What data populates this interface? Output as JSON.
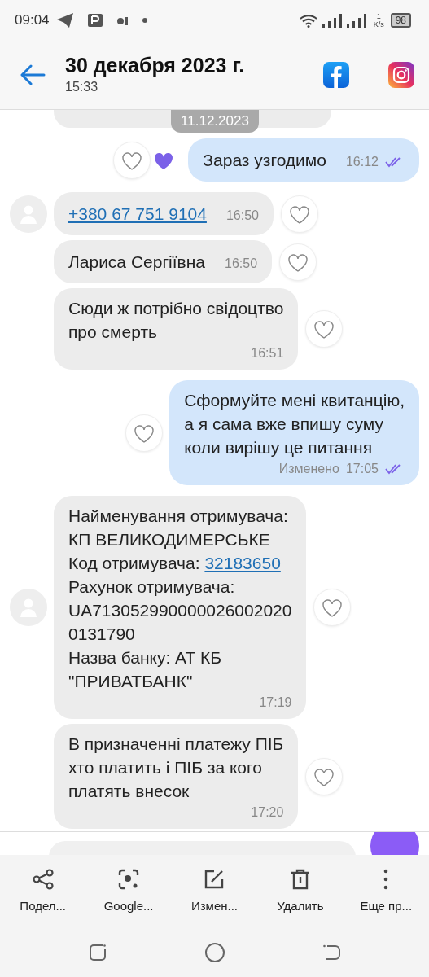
{
  "status_bar": {
    "time": "09:04",
    "net_speed_value": "1",
    "net_speed_unit": "K/s",
    "battery": "98"
  },
  "header": {
    "title": "30 декабря 2023 г.",
    "subtitle": "15:33"
  },
  "date_chip": "11.12.2023",
  "messages": [
    {
      "kind": "outgoing",
      "lines": [
        {
          "text": "Зараз узгодимо"
        }
      ],
      "time": "16:12",
      "read": true,
      "liked": true
    },
    {
      "kind": "incoming",
      "avatar": true,
      "lines": [
        {
          "link": "+380 67 751 9104"
        }
      ],
      "time": "16:50",
      "liked": false
    },
    {
      "kind": "incoming",
      "avatar": false,
      "lines": [
        {
          "text": "Лариса Сергіївна"
        }
      ],
      "time": "16:50",
      "liked": false
    },
    {
      "kind": "incoming",
      "avatar": false,
      "lines": [
        {
          "text": "Сюди ж потрібно свідоцтво"
        },
        {
          "text": "про смерть"
        }
      ],
      "time": "16:51",
      "liked": false
    },
    {
      "kind": "outgoing",
      "lines": [
        {
          "text": "Сформуйте мені квитанцію,"
        },
        {
          "text": "а я сама вже впишу суму"
        },
        {
          "text": "коли вирішу це питання"
        }
      ],
      "edited_label": "Изменено",
      "time": "17:05",
      "read": true,
      "liked": false
    },
    {
      "kind": "incoming",
      "avatar": true,
      "lines": [
        {
          "text": "Найменування отримувача:"
        },
        {
          "text": "КП ВЕЛИКОДИМЕРСЬКЕ"
        },
        {
          "text": "Код отримувача: ",
          "link": "32183650"
        },
        {
          "text": "Рахунок отримувача:"
        },
        {
          "text": "UA713052990000026002020"
        },
        {
          "text": "0131790"
        },
        {
          "text": "Назва банку: АТ КБ"
        },
        {
          "text": "\"ПРИВАТБАНК\""
        }
      ],
      "time": "17:19",
      "liked": false
    },
    {
      "kind": "incoming",
      "avatar": false,
      "lines": [
        {
          "text": "В призначенні платежу ПІБ"
        },
        {
          "text": "хто платить і ПІБ за кого"
        },
        {
          "text": "платять внесок"
        }
      ],
      "time": "17:20",
      "liked": false
    }
  ],
  "toolbar": [
    {
      "label": "Подел..."
    },
    {
      "label": "Google..."
    },
    {
      "label": "Измен..."
    },
    {
      "label": "Удалить"
    },
    {
      "label": "Еще пр..."
    }
  ]
}
